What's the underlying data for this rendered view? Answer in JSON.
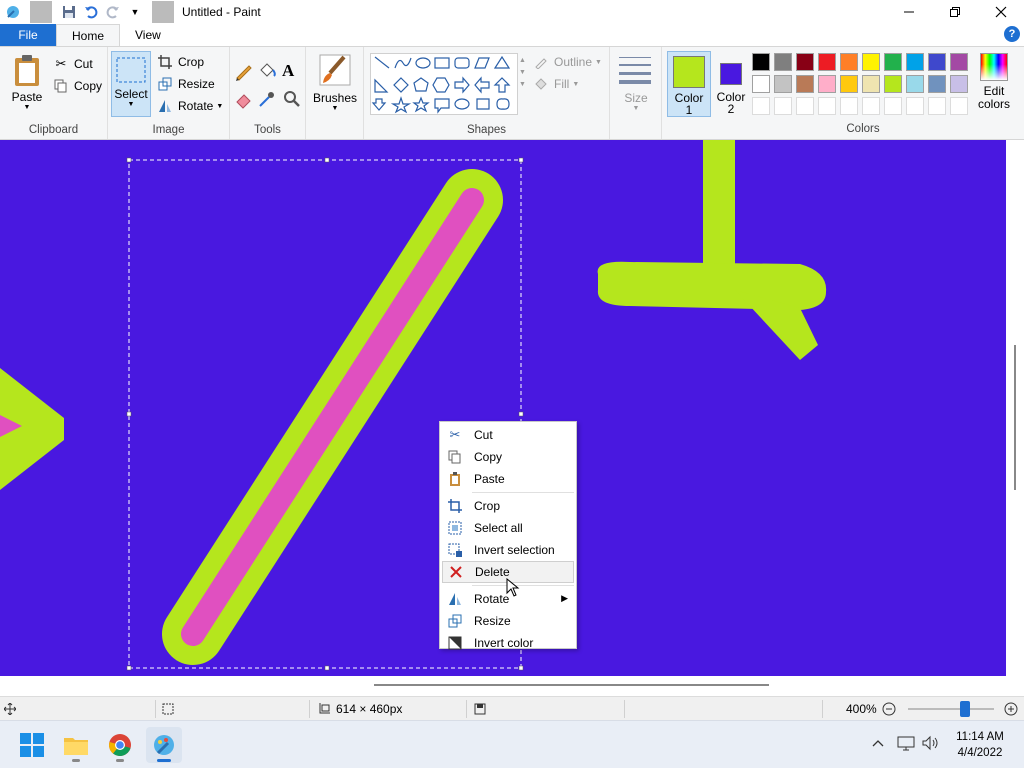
{
  "window": {
    "title": "Untitled - Paint"
  },
  "tabs": {
    "file": "File",
    "home": "Home",
    "view": "View"
  },
  "ribbon": {
    "clipboard": {
      "label": "Clipboard",
      "paste": "Paste",
      "cut": "Cut",
      "copy": "Copy"
    },
    "image": {
      "label": "Image",
      "select": "Select",
      "crop": "Crop",
      "resize": "Resize",
      "rotate": "Rotate"
    },
    "tools": {
      "label": "Tools"
    },
    "brushes": {
      "label": "Brushes"
    },
    "shapes": {
      "label": "Shapes",
      "outline": "Outline",
      "fill": "Fill"
    },
    "size": {
      "label": "Size"
    },
    "color1": {
      "label1": "Color",
      "label2": "1",
      "value": "#b5e61d"
    },
    "color2": {
      "label1": "Color",
      "label2": "2",
      "value": "#4918e0"
    },
    "colors": {
      "label": "Colors",
      "edit1": "Edit",
      "edit2": "colors",
      "row1": [
        "#000000",
        "#7f7f7f",
        "#880015",
        "#ed1c24",
        "#ff7f27",
        "#fff200",
        "#22b14c",
        "#00a2e8",
        "#3f48cc",
        "#a349a4"
      ],
      "row2": [
        "#ffffff",
        "#c3c3c3",
        "#b97a57",
        "#ffaec9",
        "#ffc90e",
        "#efe4b0",
        "#b5e61d",
        "#99d9ea",
        "#7092be",
        "#c8bfe7"
      ],
      "row3": [
        "#ffffff",
        "#ffffff",
        "#ffffff",
        "#ffffff",
        "#ffffff",
        "#ffffff",
        "#ffffff",
        "#ffffff",
        "#ffffff",
        "#ffffff"
      ]
    }
  },
  "canvas": {
    "background": "#4918e0",
    "accent": "#b5e61d",
    "pink": "#e050c0"
  },
  "context_menu": {
    "items": [
      {
        "label": "Cut"
      },
      {
        "label": "Copy"
      },
      {
        "label": "Paste"
      },
      {
        "label": "Crop"
      },
      {
        "label": "Select all"
      },
      {
        "label": "Invert selection"
      },
      {
        "label": "Delete"
      },
      {
        "label": "Rotate"
      },
      {
        "label": "Resize"
      },
      {
        "label": "Invert color"
      }
    ]
  },
  "status": {
    "selection_size": "614 × 460px",
    "zoom": "400%"
  },
  "taskbar": {
    "time": "11:14 AM",
    "date": "4/4/2022"
  }
}
